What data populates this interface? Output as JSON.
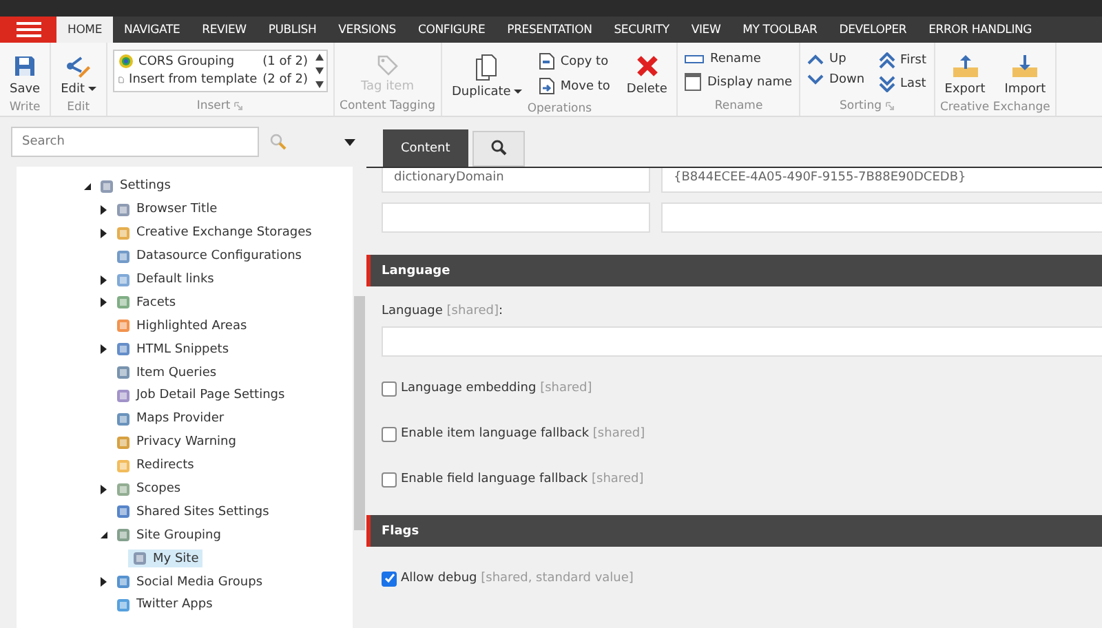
{
  "top_tabs": [
    {
      "label": "HOME",
      "selected": true
    },
    {
      "label": "NAVIGATE",
      "selected": false
    },
    {
      "label": "REVIEW",
      "selected": false
    },
    {
      "label": "PUBLISH",
      "selected": false
    },
    {
      "label": "VERSIONS",
      "selected": false
    },
    {
      "label": "CONFIGURE",
      "selected": false
    },
    {
      "label": "PRESENTATION",
      "selected": false
    },
    {
      "label": "SECURITY",
      "selected": false
    },
    {
      "label": "VIEW",
      "selected": false
    },
    {
      "label": "MY TOOLBAR",
      "selected": false
    },
    {
      "label": "DEVELOPER",
      "selected": false
    },
    {
      "label": "ERROR HANDLING",
      "selected": false
    }
  ],
  "ribbon": [
    {
      "label": "Write",
      "launcher": false,
      "columns": [
        {
          "kind": "large",
          "label": "Save",
          "dropdown": false,
          "disabled": false
        }
      ]
    },
    {
      "label": "Edit",
      "launcher": false,
      "columns": [
        {
          "kind": "large",
          "label": "Edit",
          "dropdown": true,
          "disabled": false
        }
      ]
    },
    {
      "label": "Insert",
      "launcher": true,
      "columns": [
        {
          "kind": "list",
          "entries": [
            {
              "label": "CORS Grouping",
              "count": "(1 of 2)"
            },
            {
              "label": "Insert from template",
              "count": "(2 of 2)"
            }
          ]
        }
      ]
    },
    {
      "label": "Content Tagging",
      "launcher": false,
      "columns": [
        {
          "kind": "large",
          "label": "Tag item",
          "dropdown": false,
          "disabled": true
        }
      ]
    },
    {
      "label": "Operations",
      "launcher": false,
      "columns": [
        {
          "kind": "large",
          "label": "Duplicate",
          "dropdown": true,
          "disabled": false
        },
        {
          "kind": "stack",
          "buttons": [
            "Copy to",
            "Move to"
          ]
        },
        {
          "kind": "large",
          "label": "Delete",
          "dropdown": false,
          "disabled": false
        }
      ]
    },
    {
      "label": "Rename",
      "launcher": false,
      "columns": [
        {
          "kind": "stack",
          "buttons": [
            "Rename",
            "Display name"
          ]
        }
      ]
    },
    {
      "label": "Sorting",
      "launcher": true,
      "columns": [
        {
          "kind": "stack",
          "buttons": [
            "Up",
            "Down"
          ]
        },
        {
          "kind": "stack",
          "buttons": [
            "First",
            "Last"
          ]
        }
      ]
    },
    {
      "label": "Creative Exchange",
      "launcher": false,
      "columns": [
        {
          "kind": "large",
          "label": "Export",
          "dropdown": false,
          "disabled": false
        },
        {
          "kind": "large",
          "label": "Import",
          "dropdown": false,
          "disabled": false
        }
      ]
    }
  ],
  "search": {
    "placeholder": "Search"
  },
  "tree": [
    {
      "label": "Settings",
      "expanded": true,
      "selected": false,
      "children": [
        {
          "label": "Browser Title",
          "expanded": false,
          "selected": false
        },
        {
          "label": "Creative Exchange Storages",
          "expanded": false,
          "selected": false
        },
        {
          "label": "Datasource Configurations",
          "selected": false
        },
        {
          "label": "Default links",
          "expanded": false,
          "selected": false
        },
        {
          "label": "Facets",
          "expanded": false,
          "selected": false
        },
        {
          "label": "Highlighted Areas",
          "selected": false
        },
        {
          "label": "HTML Snippets",
          "expanded": false,
          "selected": false
        },
        {
          "label": "Item Queries",
          "selected": false
        },
        {
          "label": "Job Detail Page Settings",
          "selected": false
        },
        {
          "label": "Maps Provider",
          "selected": false
        },
        {
          "label": "Privacy Warning",
          "selected": false
        },
        {
          "label": "Redirects",
          "selected": false
        },
        {
          "label": "Scopes",
          "expanded": false,
          "selected": false
        },
        {
          "label": "Shared Sites Settings",
          "selected": false
        },
        {
          "label": "Site Grouping",
          "expanded": true,
          "selected": false,
          "children": [
            {
              "label": "My Site",
              "selected": true
            }
          ]
        },
        {
          "label": "Social Media Groups",
          "expanded": false,
          "selected": false
        },
        {
          "label": "Twitter Apps",
          "selected": false
        }
      ]
    }
  ],
  "editor_tabs": [
    {
      "kind": "text",
      "label": "Content",
      "selected": true
    },
    {
      "kind": "search",
      "selected": false
    }
  ],
  "field_rows": [
    {
      "key": "dictionaryDomain",
      "value": "{B844ECEE-4A05-490F-9155-7B88E90DCEDB}"
    },
    {}
  ],
  "sections": [
    {
      "title": "Language",
      "fields": [
        {
          "kind": "text",
          "label": "Language",
          "note": "[shared]",
          "suffix": ":"
        },
        {
          "kind": "checkbox",
          "label": "Language embedding",
          "note": "[shared]",
          "checked": false
        },
        {
          "kind": "checkbox",
          "label": "Enable item language fallback",
          "note": "[shared]",
          "checked": false
        },
        {
          "kind": "checkbox",
          "label": "Enable field language fallback",
          "note": "[shared]",
          "checked": false
        }
      ]
    },
    {
      "title": "Flags",
      "fields": [
        {
          "kind": "checkbox",
          "label": "Allow debug",
          "note": "[shared, standard value]",
          "checked": true
        }
      ]
    }
  ]
}
